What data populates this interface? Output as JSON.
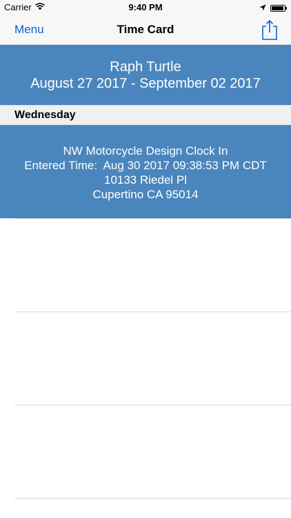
{
  "status_bar": {
    "carrier": "Carrier",
    "time": "9:40 PM",
    "battery_level": 0.95
  },
  "nav": {
    "left_label": "Menu",
    "title": "Time Card",
    "share_icon": "share-icon"
  },
  "header": {
    "name": "Raph Turtle",
    "date_range": "August 27 2017 - September 02 2017"
  },
  "section": {
    "title": "Wednesday"
  },
  "entry": {
    "line1": "NW Motorcycle Design Clock In",
    "line2": "Entered Time:  Aug 30 2017 09:38:53 PM CDT",
    "line3": "10133 Riedel Pl",
    "line4": "Cupertino CA 95014"
  },
  "colors": {
    "accent_blue": "#4a86bd",
    "nav_tint": "#0a62d0",
    "section_bg": "#f0f0f0"
  }
}
